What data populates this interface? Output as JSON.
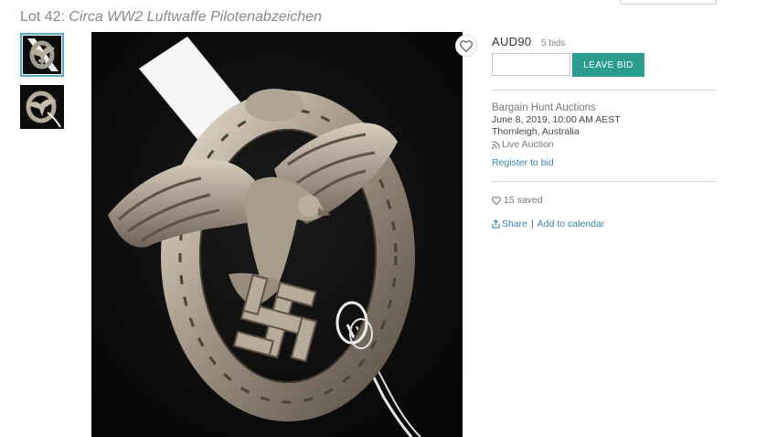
{
  "lot": {
    "number_label": "Lot 42:",
    "name": "Circa WW2 Luftwaffe Pilotenabzeichen"
  },
  "images": {
    "thumbnails": [
      "badge-front",
      "badge-angle"
    ],
    "selected_index": 0
  },
  "bidding": {
    "price": "AUD90",
    "bids": "5 bids",
    "input_value": "",
    "leave_bid_label": "LEAVE BID"
  },
  "auction": {
    "auctioneer": "Bargain Hunt Auctions",
    "date": "June 8, 2019, 10:00 AM AEST",
    "location": "Thornleigh, Australia",
    "live_label": "Live Auction",
    "register_label": "Register to bid"
  },
  "social": {
    "saved": "15 saved",
    "share_label": "Share",
    "separator": "|",
    "calendar_label": "Add to calendar"
  },
  "colors": {
    "accent": "#2a9d8f",
    "link": "#3a7fa5"
  },
  "icons": [
    "heart-icon",
    "rss-icon",
    "share-icon"
  ]
}
